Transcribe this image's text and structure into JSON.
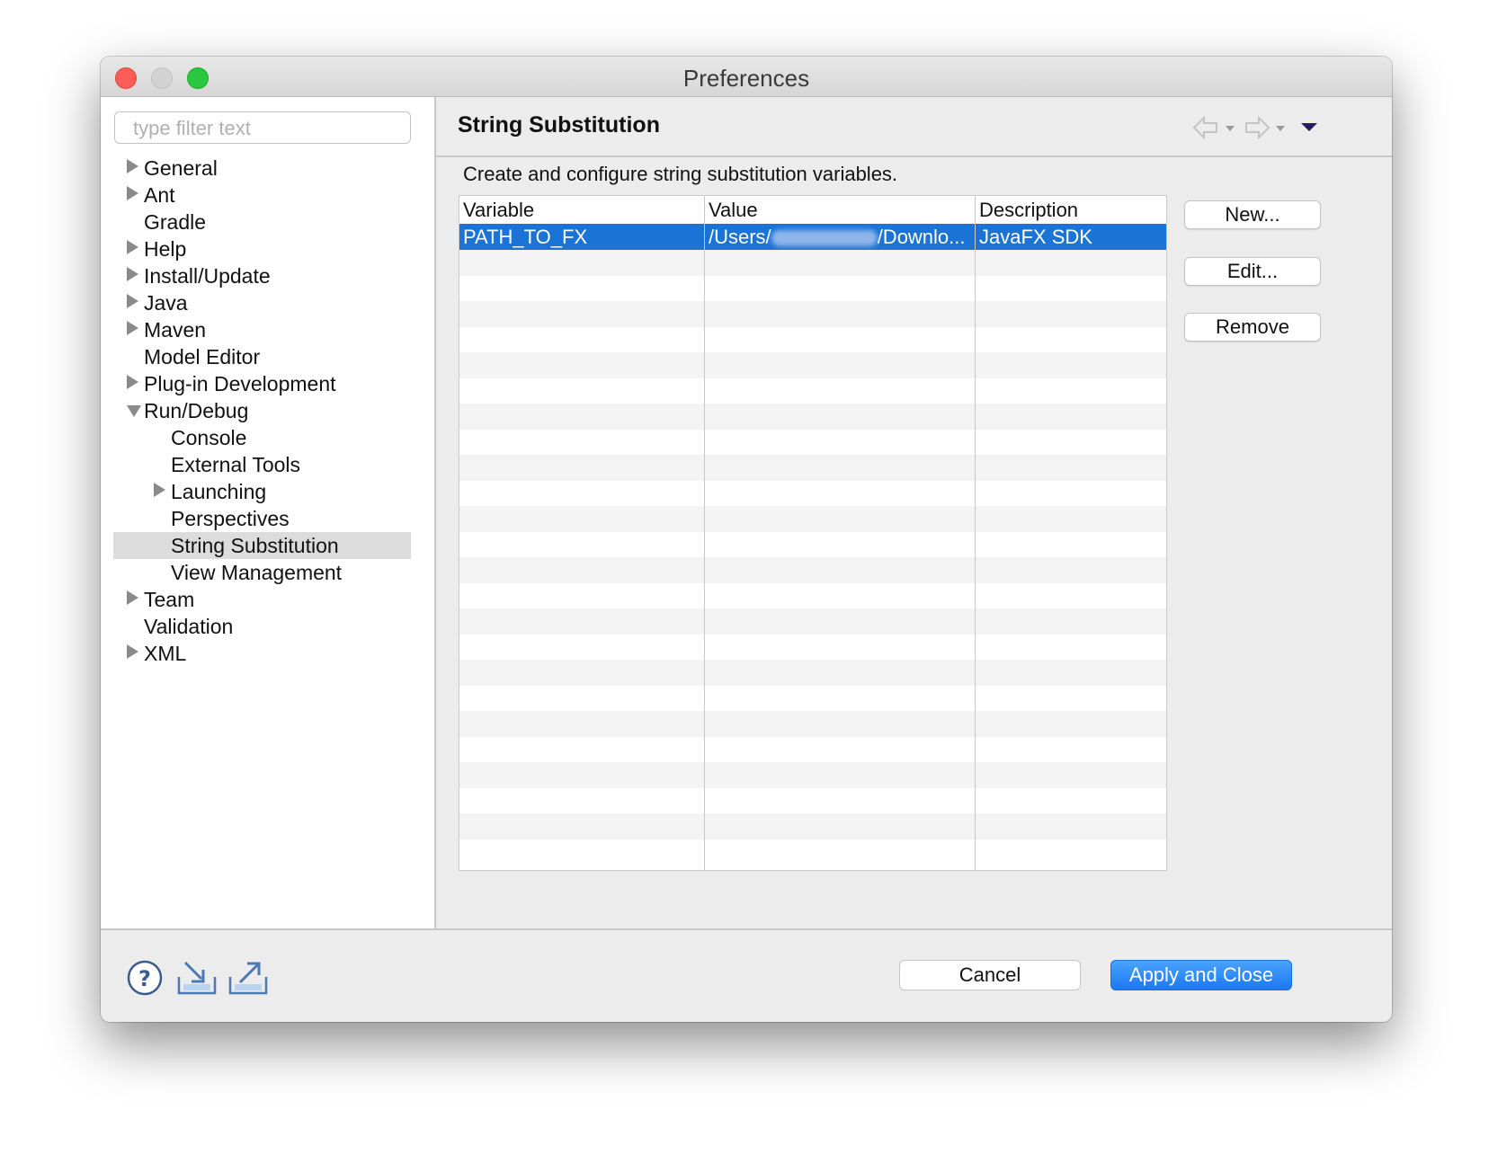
{
  "window": {
    "title": "Preferences"
  },
  "sidebar": {
    "filter_placeholder": "type filter text",
    "items": [
      {
        "label": "General",
        "expander": "collapsed",
        "level": 0
      },
      {
        "label": "Ant",
        "expander": "collapsed",
        "level": 0
      },
      {
        "label": "Gradle",
        "expander": "none",
        "level": 0
      },
      {
        "label": "Help",
        "expander": "collapsed",
        "level": 0
      },
      {
        "label": "Install/Update",
        "expander": "collapsed",
        "level": 0
      },
      {
        "label": "Java",
        "expander": "collapsed",
        "level": 0
      },
      {
        "label": "Maven",
        "expander": "collapsed",
        "level": 0
      },
      {
        "label": "Model Editor",
        "expander": "none",
        "level": 0
      },
      {
        "label": "Plug-in Development",
        "expander": "collapsed",
        "level": 0
      },
      {
        "label": "Run/Debug",
        "expander": "expanded",
        "level": 0
      },
      {
        "label": "Console",
        "expander": "none",
        "level": 1
      },
      {
        "label": "External Tools",
        "expander": "none",
        "level": 1
      },
      {
        "label": "Launching",
        "expander": "collapsed",
        "level": 1
      },
      {
        "label": "Perspectives",
        "expander": "none",
        "level": 1
      },
      {
        "label": "String Substitution",
        "expander": "none",
        "level": 1,
        "selected": true
      },
      {
        "label": "View Management",
        "expander": "none",
        "level": 1
      },
      {
        "label": "Team",
        "expander": "collapsed",
        "level": 0
      },
      {
        "label": "Validation",
        "expander": "none",
        "level": 0
      },
      {
        "label": "XML",
        "expander": "collapsed",
        "level": 0
      }
    ]
  },
  "page": {
    "title": "String Substitution",
    "description": "Create and configure string substitution variables."
  },
  "table": {
    "columns": [
      "Variable",
      "Value",
      "Description"
    ],
    "rows": [
      {
        "variable": "PATH_TO_FX",
        "value_prefix": "/Users/",
        "value_suffix": "/Downlo...",
        "description": "JavaFX SDK",
        "selected": true
      }
    ]
  },
  "side_buttons": {
    "new": "New...",
    "edit": "Edit...",
    "remove": "Remove"
  },
  "footer": {
    "cancel": "Cancel",
    "apply_close": "Apply and Close"
  },
  "colors": {
    "selection": "#1b73d6",
    "primary_button": "#1a78f2",
    "accent_arrow": "#2a1a5e"
  }
}
